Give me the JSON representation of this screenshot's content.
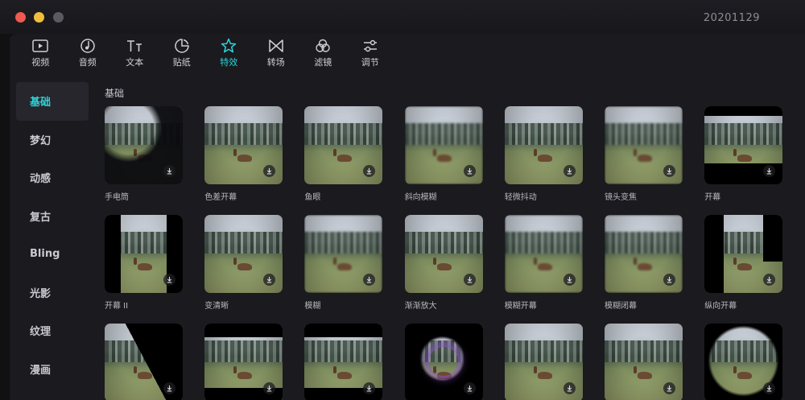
{
  "window": {
    "title": "20201129"
  },
  "toolbar": {
    "items": [
      {
        "label": "视频",
        "icon": "video-icon",
        "active": false
      },
      {
        "label": "音频",
        "icon": "music-note-icon",
        "active": false
      },
      {
        "label": "文本",
        "icon": "text-icon",
        "active": false
      },
      {
        "label": "贴纸",
        "icon": "sticker-icon",
        "active": false
      },
      {
        "label": "特效",
        "icon": "sparkle-star-icon",
        "active": true
      },
      {
        "label": "转场",
        "icon": "bowtie-icon",
        "active": false
      },
      {
        "label": "滤镜",
        "icon": "filter-circles-icon",
        "active": false
      },
      {
        "label": "调节",
        "icon": "sliders-icon",
        "active": false
      }
    ]
  },
  "sidebar": {
    "items": [
      {
        "label": "基础",
        "active": true
      },
      {
        "label": "梦幻",
        "active": false
      },
      {
        "label": "动感",
        "active": false
      },
      {
        "label": "复古",
        "active": false
      },
      {
        "label": "Bling",
        "active": false
      },
      {
        "label": "光影",
        "active": false
      },
      {
        "label": "纹理",
        "active": false
      },
      {
        "label": "漫画",
        "active": false
      }
    ]
  },
  "section": {
    "title": "基础"
  },
  "effects": [
    {
      "name": "手电筒",
      "style": "flash"
    },
    {
      "name": "色差开幕",
      "style": "plain"
    },
    {
      "name": "鱼眼",
      "style": "plain"
    },
    {
      "name": "斜向模糊",
      "style": "blur"
    },
    {
      "name": "轻微抖动",
      "style": "plain"
    },
    {
      "name": "镜头变焦",
      "style": "blur"
    },
    {
      "name": "开幕",
      "style": "letterbox"
    },
    {
      "name": "开幕 II",
      "style": "split"
    },
    {
      "name": "变清晰",
      "style": "plain"
    },
    {
      "name": "模糊",
      "style": "blur"
    },
    {
      "name": "渐渐放大",
      "style": "plain"
    },
    {
      "name": "模糊开幕",
      "style": "blur"
    },
    {
      "name": "模糊闭幕",
      "style": "blur"
    },
    {
      "name": "纵向开幕",
      "style": "vertical"
    },
    {
      "name": "",
      "style": "diagonal"
    },
    {
      "name": "",
      "style": "bars"
    },
    {
      "name": "",
      "style": "bars"
    },
    {
      "name": "",
      "style": "purple"
    },
    {
      "name": "",
      "style": "plain"
    },
    {
      "name": "",
      "style": "plain"
    },
    {
      "name": "",
      "style": "spot-big"
    }
  ],
  "colors": {
    "accent": "#2ed3d6",
    "background": "#111114",
    "panel": "#1a1a1f",
    "close": "#ee5a52",
    "minimize": "#f2bd3d"
  }
}
